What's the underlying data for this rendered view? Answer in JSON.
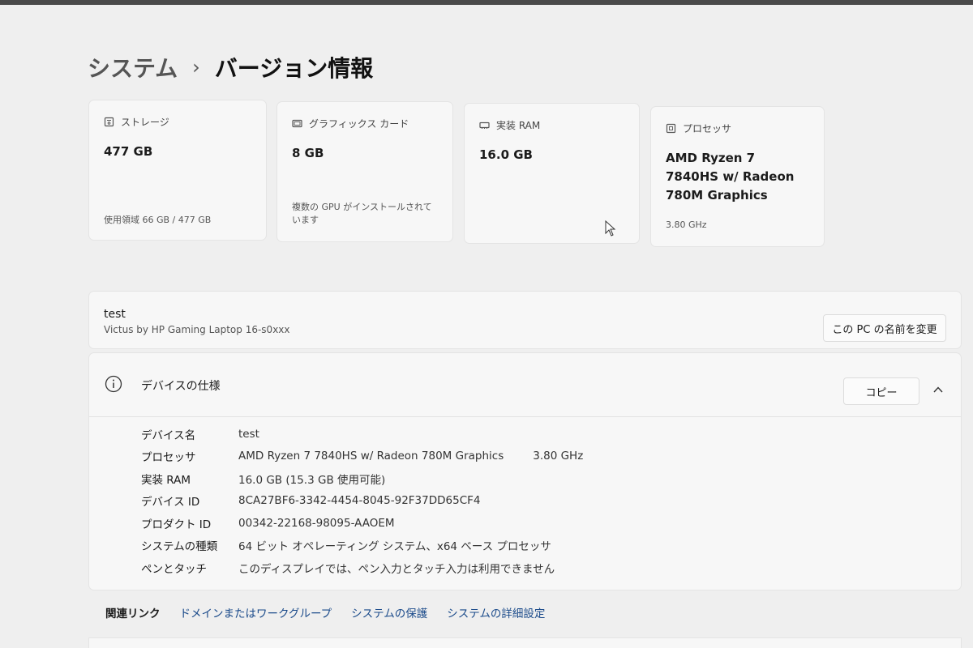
{
  "breadcrumb": {
    "parent": "システム",
    "separator": "›",
    "current": "バージョン情報"
  },
  "cards": [
    {
      "id": "storage",
      "icon": "storage-icon",
      "title": "ストレージ",
      "value": "477 GB",
      "sub": "使用領域 66 GB / 477 GB"
    },
    {
      "id": "graphics",
      "icon": "graphics-card-icon",
      "title": "グラフィックス カード",
      "value": "8 GB",
      "sub": "複数の GPU がインストールされています"
    },
    {
      "id": "ram",
      "icon": "memory-icon",
      "title": "実装 RAM",
      "value": "16.0 GB",
      "sub": ""
    },
    {
      "id": "processor",
      "icon": "processor-icon",
      "title": "プロセッサ",
      "value": "AMD Ryzen 7 7840HS w/ Radeon 780M Graphics",
      "sub": "3.80 GHz"
    }
  ],
  "device": {
    "name": "test",
    "model": "Victus by HP Gaming Laptop 16-s0xxx",
    "rename_label": "この PC の名前を変更"
  },
  "specs": {
    "title": "デバイスの仕様",
    "copy_label": "コピー",
    "rows": [
      {
        "label": "デバイス名",
        "value": "test",
        "extra": ""
      },
      {
        "label": "プロセッサ",
        "value": "AMD Ryzen 7 7840HS w/ Radeon 780M Graphics",
        "extra": "3.80 GHz"
      },
      {
        "label": "実装 RAM",
        "value": "16.0 GB (15.3 GB 使用可能)",
        "extra": ""
      },
      {
        "label": "デバイス ID",
        "value": "8CA27BF6-3342-4454-8045-92F37DD65CF4",
        "extra": ""
      },
      {
        "label": "プロダクト ID",
        "value": "00342-22168-98095-AAOEM",
        "extra": ""
      },
      {
        "label": "システムの種類",
        "value": "64 ビット オペレーティング システム、x64 ベース プロセッサ",
        "extra": ""
      },
      {
        "label": "ペンとタッチ",
        "value": "このディスプレイでは、ペン入力とタッチ入力は利用できません",
        "extra": ""
      }
    ]
  },
  "related_links": {
    "title": "関連リンク",
    "links": [
      "ドメインまたはワークグループ",
      "システムの保護",
      "システムの詳細設定"
    ]
  }
}
